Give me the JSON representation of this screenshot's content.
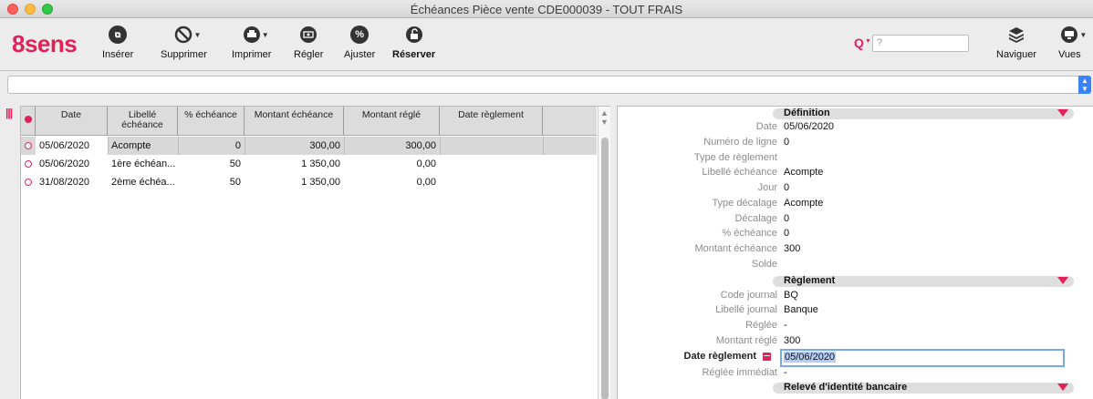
{
  "window": {
    "title": "Échéances  Pièce vente CDE000039 - TOUT FRAIS"
  },
  "toolbar": {
    "logo": "8sens",
    "buttons": [
      {
        "label": "Insérer",
        "icon": "insert-icon"
      },
      {
        "label": "Supprimer",
        "icon": "delete-icon"
      },
      {
        "label": "Imprimer",
        "icon": "print-icon"
      },
      {
        "label": "Régler",
        "icon": "pay-icon"
      },
      {
        "label": "Ajuster",
        "icon": "percent-icon"
      },
      {
        "label": "Réserver",
        "icon": "reserve-icon"
      }
    ],
    "search_placeholder": "?",
    "right_buttons": [
      {
        "label": "Naviguer",
        "icon": "layers-icon"
      },
      {
        "label": "Vues",
        "icon": "monitor-icon"
      }
    ]
  },
  "grid": {
    "columns": [
      "Date",
      "Libellé échéance",
      "% échéance",
      "Montant échéance",
      "Montant réglé",
      "Date règlement"
    ],
    "rows": [
      {
        "date": "05/06/2020",
        "libelle": "Acompte",
        "pct": "0",
        "montant": "300,00",
        "regle": "300,00",
        "date_reglement": "",
        "selected": true
      },
      {
        "date": "05/06/2020",
        "libelle": "1ère échéan...",
        "pct": "50",
        "montant": "1 350,00",
        "regle": "0,00",
        "date_reglement": "",
        "selected": false
      },
      {
        "date": "31/08/2020",
        "libelle": "2ème échéa...",
        "pct": "50",
        "montant": "1 350,00",
        "regle": "0,00",
        "date_reglement": "",
        "selected": false
      }
    ]
  },
  "detail": {
    "sections": {
      "definition": "Définition",
      "reglement": "Règlement",
      "rib": "Relevé d'identité bancaire"
    },
    "definition_fields": [
      {
        "label": "Date",
        "value": "05/06/2020"
      },
      {
        "label": "Numéro de ligne",
        "value": "0"
      },
      {
        "label": "Type de règlement",
        "value": ""
      },
      {
        "label": "Libellé échéance",
        "value": "Acompte"
      },
      {
        "label": "Jour",
        "value": "0"
      },
      {
        "label": "Type décalage",
        "value": "Acompte"
      },
      {
        "label": "Décalage",
        "value": "0"
      },
      {
        "label": "% échéance",
        "value": "0"
      },
      {
        "label": "Montant échéance",
        "value": "300"
      },
      {
        "label": "Solde",
        "value": ""
      }
    ],
    "reglement_fields": [
      {
        "label": "Code journal",
        "value": "BQ"
      },
      {
        "label": "Libellé journal",
        "value": "Banque"
      },
      {
        "label": "Réglée",
        "value": "-"
      },
      {
        "label": "Montant réglé",
        "value": "300"
      },
      {
        "label": "Date règlement",
        "value": "05/06/2020"
      },
      {
        "label": "Réglée immédiat",
        "value": "-"
      }
    ]
  },
  "colors": {
    "brand": "#e0215a",
    "selection": "#b3cdf4",
    "focus_ring": "#7aa7e6"
  }
}
